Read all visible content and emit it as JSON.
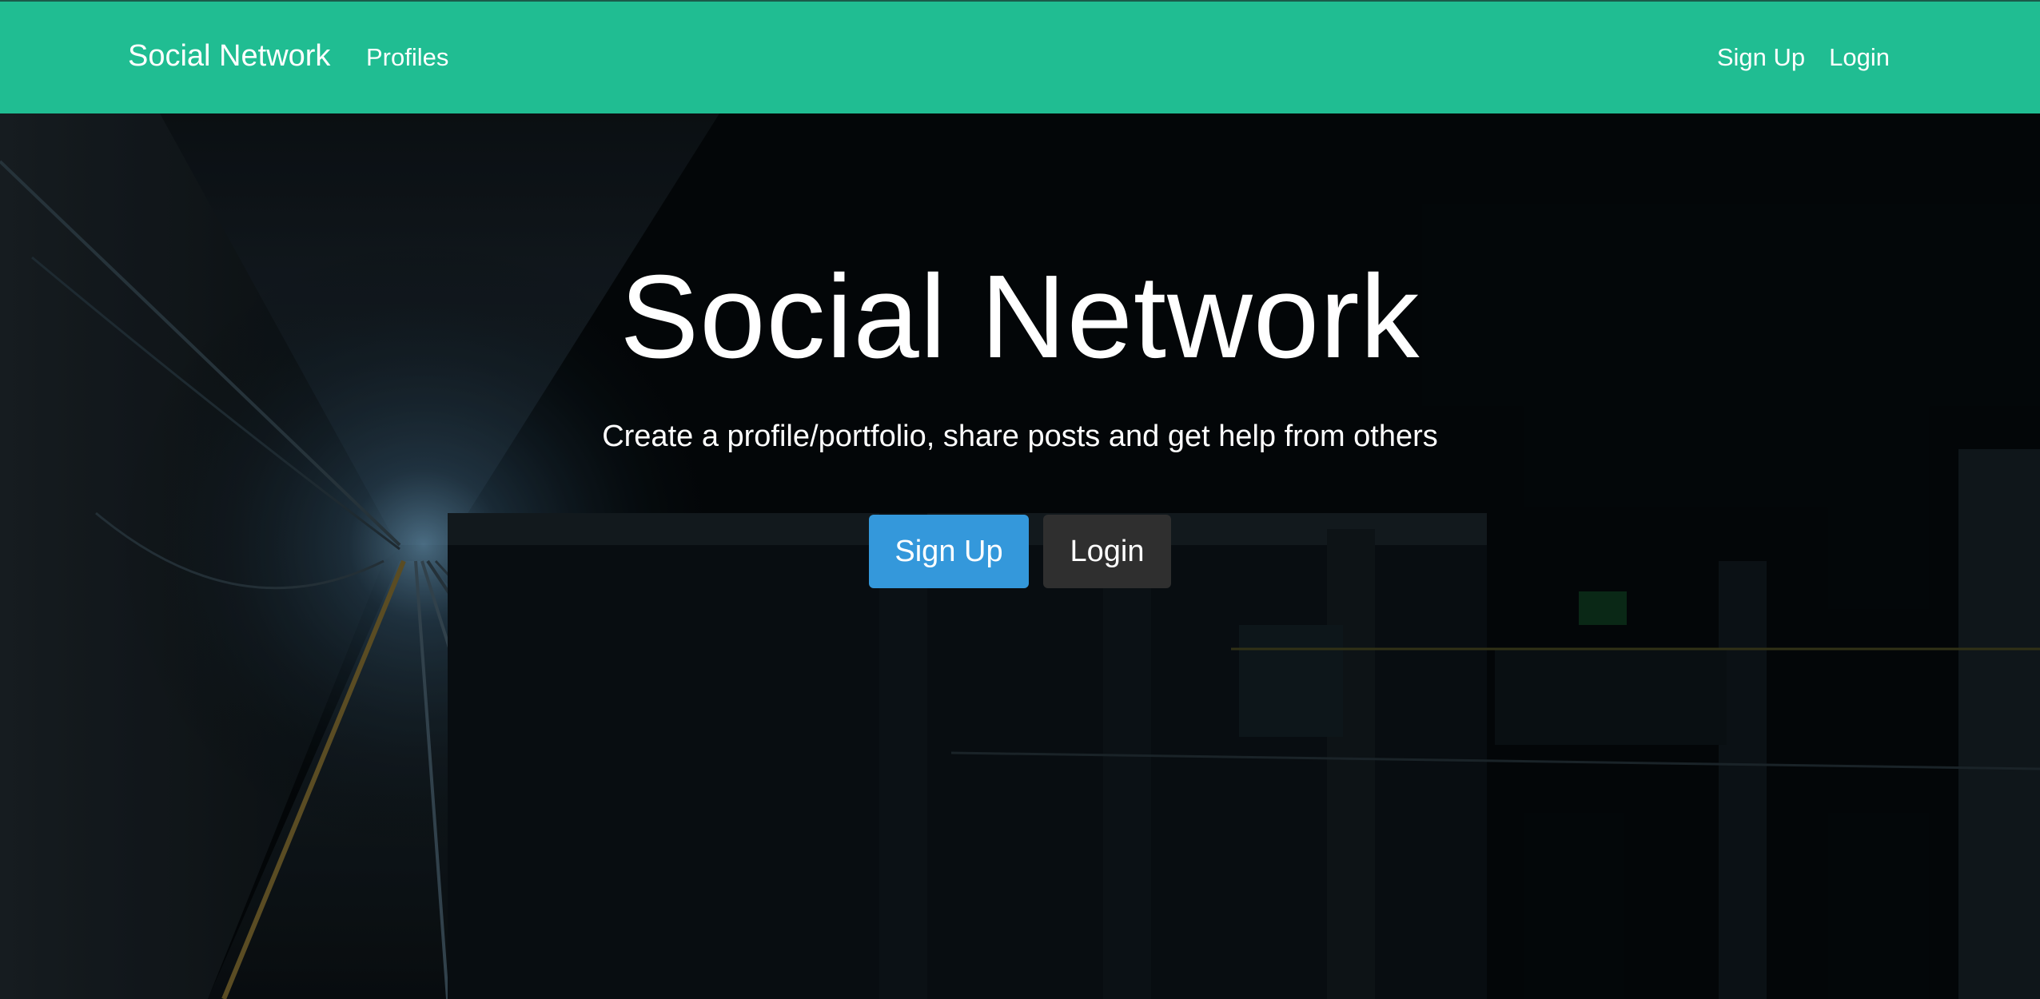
{
  "navbar": {
    "brand": "Social Network",
    "links": {
      "profiles": "Profiles",
      "signup": "Sign Up",
      "login": "Login"
    },
    "background_color": "#20bd92"
  },
  "hero": {
    "title": "Social Network",
    "subtitle": "Create a profile/portfolio, share posts and get help from others",
    "buttons": {
      "signup": "Sign Up",
      "login": "Login"
    },
    "signup_color": "#3498db",
    "login_color": "#2f2f2f",
    "background_image": "dark-subway-tunnel-photo"
  }
}
